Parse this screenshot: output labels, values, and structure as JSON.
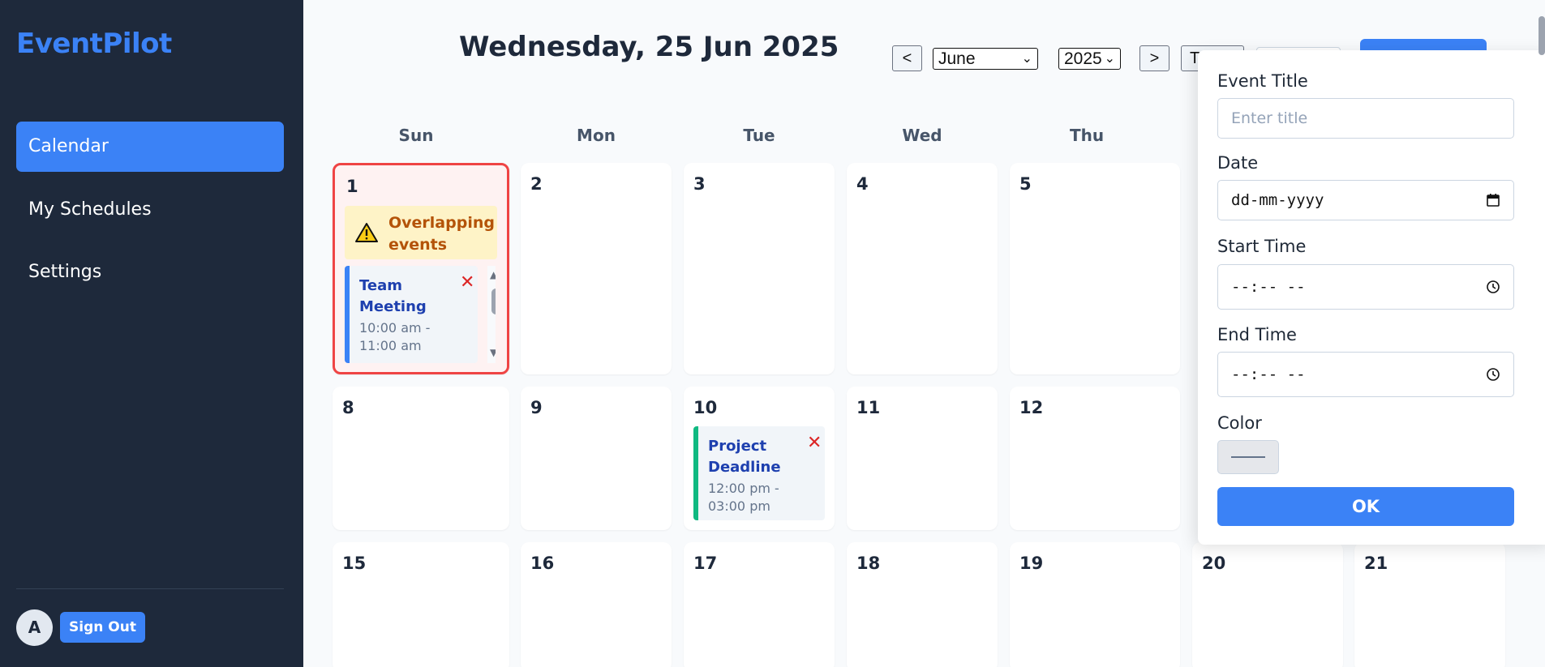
{
  "app": {
    "name": "EventPilot"
  },
  "sidebar": {
    "items": [
      {
        "label": "Calendar",
        "active": true
      },
      {
        "label": "My Schedules",
        "active": false
      },
      {
        "label": "Settings",
        "active": false
      }
    ],
    "user": {
      "avatar_initial": "A",
      "sign_out_label": "Sign Out"
    }
  },
  "header": {
    "title": "Wednesday, 25 Jun 2025",
    "prev_label": "<",
    "next_label": ">",
    "month_value": "June",
    "year_value": "2025",
    "today_label_partial": "T"
  },
  "weekdays": [
    "Sun",
    "Mon",
    "Tue",
    "Wed",
    "Thu"
  ],
  "weeks": [
    {
      "days": [
        "1",
        "2",
        "3",
        "4",
        "5"
      ]
    },
    {
      "days": [
        "8",
        "9",
        "10",
        "11",
        "12"
      ]
    },
    {
      "days": [
        "15",
        "16",
        "17",
        "18",
        "19",
        "20",
        "21"
      ]
    }
  ],
  "overlap_warning": {
    "text": "Overlapping events"
  },
  "events": [
    {
      "title": "Team Meeting",
      "time": "10:00 am - 11:00 am",
      "color": "#3b82f6",
      "day": "1"
    },
    {
      "title": "Project Deadline",
      "time": "12:00 pm - 03:00 pm",
      "color": "#10b981",
      "day": "10"
    }
  ],
  "modal": {
    "title_label": "Event Title",
    "title_placeholder": "Enter title",
    "date_label": "Date",
    "date_placeholder": "dd-mm-yyyy",
    "start_label": "Start Time",
    "start_placeholder": "--:-- --",
    "end_label": "End Time",
    "end_placeholder": "--:-- --",
    "color_label": "Color",
    "ok_label": "OK"
  },
  "colors": {
    "accent": "#3b82f6",
    "sidebar_bg": "#1e293b",
    "overlap_border": "#ef4444",
    "warning_bg": "#fef3c7"
  }
}
